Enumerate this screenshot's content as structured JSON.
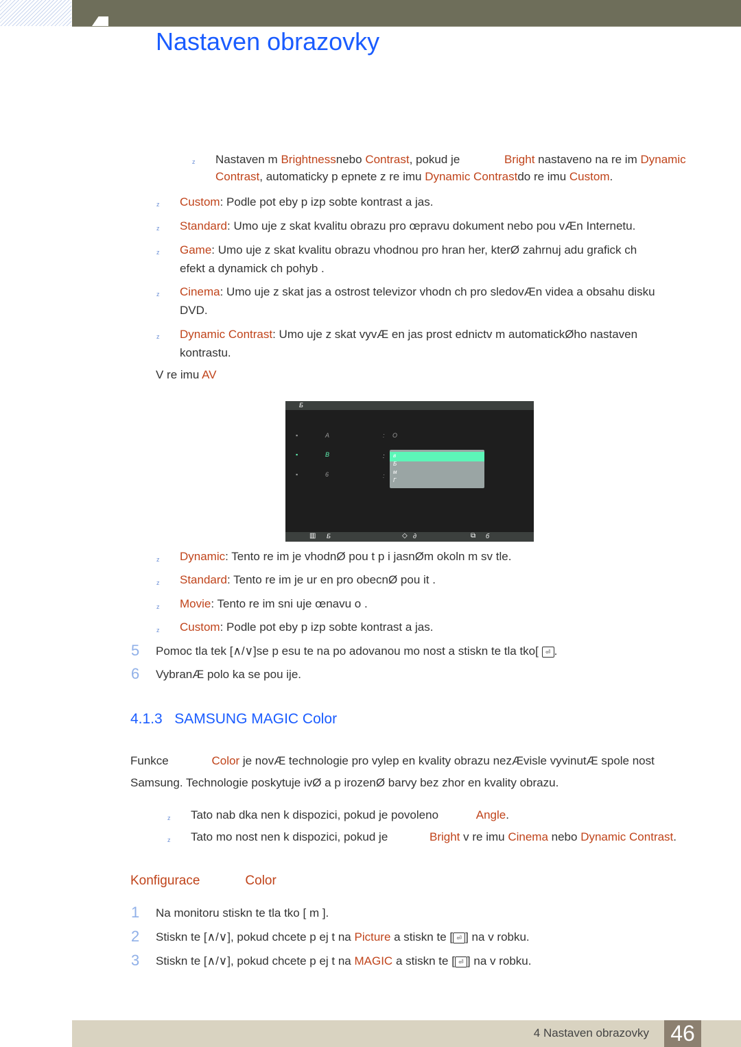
{
  "header": {
    "title": "Nastaven  obrazovky",
    "chapter_number": "4"
  },
  "bullets_top": [
    {
      "note": true,
      "parts": [
        {
          "t": "Nastaven m "
        },
        {
          "t": "Brightness",
          "o": 1
        },
        {
          "t": "nebo "
        },
        {
          "t": "Contrast",
          "o": 1
        },
        {
          "t": ", pokud je "
        },
        {
          "t": "Bright",
          "o": 1
        },
        {
          "t": " nastaveno na re im "
        },
        {
          "t": "Dynamic",
          "o": 1
        }
      ],
      "line2": [
        {
          "t": "Contrast",
          "o": 1
        },
        {
          "t": ", automaticky p epnete z re imu "
        },
        {
          "t": "Dynamic Contrast",
          "o": 1
        },
        {
          "t": "do re imu  "
        },
        {
          "t": "Custom",
          "o": 1
        },
        {
          "t": "."
        }
      ]
    }
  ],
  "modes_pc": [
    {
      "label": "Custom",
      "text": ": Podle pot eby p izp sobte kontrast a jas."
    },
    {
      "label": "Standard",
      "text": ": Umo  uje z skat kvalitu obrazu pro œpravu dokument  nebo pou  vÆn  Internetu."
    },
    {
      "label": "Game",
      "text": ": Umo  uje z skat kvalitu obrazu vhodnou pro hran  her, kterØ zahrnuj   adu grafick ch",
      "line2": "efekt  a dynamick ch pohyb ."
    },
    {
      "label": "Cinema",
      "text": ": Umo  uje z skat jas a ostrost televizor  vhodn ch pro sledovÆn  videa a obsahu disku",
      "line2": "DVD."
    },
    {
      "label": "Dynamic Contrast",
      "text": ": Umo  uje z skat vyvÆ en  jas prost ednictv m automatickØho nastaven",
      "line2": "kontrastu."
    }
  ],
  "av_mode": {
    "prefix": "V re imu ",
    "label": "AV"
  },
  "osd": {
    "title_glyph": "Б",
    "rows": [
      {
        "glyph": "A",
        "value": "O"
      },
      {
        "glyph": "B",
        "value": ""
      },
      {
        "glyph": "6",
        "value": ""
      }
    ],
    "dropdown": [
      "в",
      "Б",
      "м",
      "Г"
    ],
    "footer": [
      {
        "icon": "move-icon",
        "glyph": "Б"
      },
      {
        "icon": "adjust-icon",
        "glyph": "д"
      },
      {
        "icon": "enter-icon",
        "glyph": "б"
      }
    ]
  },
  "modes_av": [
    {
      "label": "Dynamic",
      "text": ": Tento re im je vhodnØ pou  t p i jasnØm okoln m sv tle."
    },
    {
      "label": "Standard",
      "text": ": Tento re im je ur en pro obecnØ pou it ."
    },
    {
      "label": "Movie",
      "text": ": Tento re im sni uje œnavu o  ."
    },
    {
      "label": "Custom",
      "text": ": Podle pot eby p izp sobte kontrast a jas."
    }
  ],
  "steps_a": [
    {
      "n": "5",
      "text": "Pomoc  tla  tek [",
      "arrows": "∧/∨",
      "text2": "]se p esu te na po adovanou mo nost a stiskn te tla  tko[",
      "end": "."
    },
    {
      "n": "6",
      "text": "VybranÆ polo ka se pou ije."
    }
  ],
  "section": {
    "number": "4.1.3",
    "title": "SAMSUNG MAGIC Color"
  },
  "intro": {
    "line1_a": "Funkce ",
    "line1_b": "Color",
    "line1_c": " je novÆ technologie pro vylep en  kvality obrazu nezÆvisle vyvinutÆ spole nost",
    "line2": "Samsung. Technologie poskytuje  ivØ a p irozenØ barvy bez zhor en  kvality obrazu."
  },
  "notes": [
    {
      "parts": [
        {
          "t": "Tato nab dka nen  k dispozici, pokud je povoleno "
        },
        {
          "t": "Angle",
          "o": 1
        },
        {
          "t": "."
        }
      ]
    },
    {
      "parts": [
        {
          "t": "Tato mo nost nen  k dispozici, pokud je "
        },
        {
          "t": "Bright",
          "o": 1
        },
        {
          "t": " v re imu "
        },
        {
          "t": "Cinema",
          "o": 1
        },
        {
          "t": " nebo "
        },
        {
          "t": "Dynamic Contrast",
          "o": 1
        },
        {
          "t": "."
        }
      ]
    }
  ],
  "subsection": {
    "a": "Konfigurace",
    "b": "Color"
  },
  "steps_b": [
    {
      "n": "1",
      "text": "Na monitoru stiskn te tla  tko [",
      "key": "m",
      "end": " ]."
    },
    {
      "n": "2",
      "text": "Stiskn te [",
      "arrows": "∧/∨",
      "mid": "], pokud chcete p ej t na ",
      "target": "Picture",
      "end": " a stiskn te [",
      "end2": "] na v robku."
    },
    {
      "n": "3",
      "text": "Stiskn te [",
      "arrows": "∧/∨",
      "mid": "], pokud chcete p ej t na ",
      "target": "MAGIC",
      "end": " a stiskn te [",
      "end2": "] na v robku."
    }
  ],
  "footer": {
    "text": "4 Nastaven  obrazovky",
    "page": "46"
  },
  "bullet_glyph": "z",
  "colors": {
    "accent": "#c0441b",
    "title": "#1a5cff",
    "bar": "#6e6e5a"
  }
}
